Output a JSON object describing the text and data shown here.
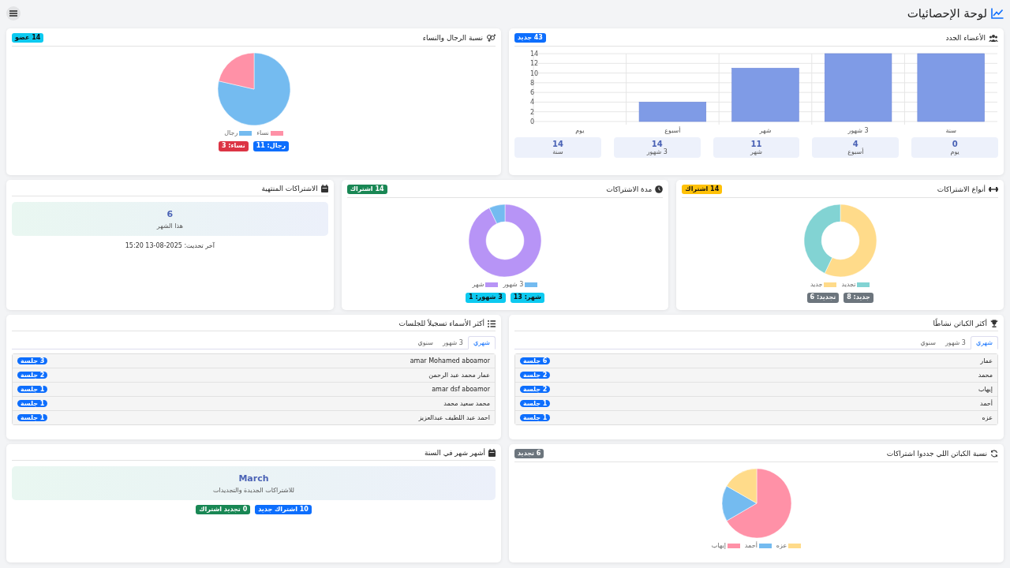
{
  "header": {
    "title": "لوحة الإحصائيات"
  },
  "new_members": {
    "title": "الأعضاء الجدد",
    "badge": {
      "text": "43 جديد",
      "color": "#0d6efd"
    },
    "chart_data": {
      "type": "bar",
      "categories": [
        "يوم",
        "أسبوع",
        "شهر",
        "3 شهور",
        "سنة"
      ],
      "values": [
        0,
        4,
        11,
        14,
        14
      ],
      "ylim": [
        0,
        14
      ],
      "yticks": [
        0,
        2,
        4,
        6,
        8,
        10,
        12,
        14
      ],
      "grid": true
    },
    "stats": [
      {
        "value": "0",
        "label": "يوم"
      },
      {
        "value": "4",
        "label": "أسبوع"
      },
      {
        "value": "11",
        "label": "شهر"
      },
      {
        "value": "14",
        "label": "3 شهور"
      },
      {
        "value": "14",
        "label": "سنة"
      }
    ]
  },
  "gender": {
    "title": "نسبة الرجال والنساء",
    "badge": {
      "text": "14 عضو",
      "color": "#0dcaf0"
    },
    "chart_data": {
      "type": "pie",
      "categories": [
        "رجال",
        "نساء"
      ],
      "values": [
        78.6,
        21.4
      ],
      "colors": [
        "#74bbf0",
        "#ff91a7"
      ],
      "legend": "bottom"
    },
    "badges": [
      {
        "text": "رجال: 11",
        "color": "#0d6efd"
      },
      {
        "text": "نساء: 3",
        "color": "#dc3545"
      }
    ]
  },
  "subscription_types": {
    "title": "أنواع الاشتراكات",
    "badge": {
      "text": "14 اشتراك",
      "color": "#ffc107"
    },
    "chart_data": {
      "type": "donut",
      "categories": [
        "جديد",
        "تجديد"
      ],
      "values": [
        57.1,
        42.9
      ],
      "colors": [
        "#ffdb8a",
        "#82d3d3"
      ],
      "legend": "bottom"
    },
    "badges": [
      {
        "text": "جديد: 8",
        "color": "#6c757d"
      },
      {
        "text": "تجديد: 6",
        "color": "#6c757d"
      }
    ]
  },
  "subscription_duration": {
    "title": "مدة الاشتراكات",
    "badge": {
      "text": "14 اشتراك",
      "color": "#198754"
    },
    "chart_data": {
      "type": "donut",
      "categories": [
        "شهر",
        "3 شهور"
      ],
      "values": [
        92.9,
        7.1
      ],
      "colors": [
        "#b794f6",
        "#74bbf0"
      ],
      "legend": "bottom"
    },
    "badges": [
      {
        "text": "شهر: 13",
        "color": "#0dcaf0"
      },
      {
        "text": "3 شهور: 1",
        "color": "#0dcaf0"
      }
    ]
  },
  "expired": {
    "title": "الاشتراكات المنتهية",
    "value": "6",
    "label": "هذا الشهر",
    "updated": "آخر تحديث: 2025-08-13 15:20"
  },
  "top_captains": {
    "title": "أكثر الكباتن نشاطًا",
    "tabs": [
      {
        "label": "شهري",
        "selected": true
      },
      {
        "label": "3 شهور",
        "selected": false
      },
      {
        "label": "سنوي",
        "selected": false
      }
    ],
    "rows": [
      {
        "name": "عمار",
        "count": "6 جلسة"
      },
      {
        "name": "محمد",
        "count": "2 جلسة"
      },
      {
        "name": "إيهاب",
        "count": "2 جلسة"
      },
      {
        "name": "أحمد",
        "count": "1 جلسة"
      },
      {
        "name": "عزه",
        "count": "1 جلسة"
      }
    ]
  },
  "top_names": {
    "title": "أكثر الأسماء تسجيلاً للجلسات",
    "tabs": [
      {
        "label": "شهري",
        "selected": true
      },
      {
        "label": "3 شهور",
        "selected": false
      },
      {
        "label": "سنوي",
        "selected": false
      }
    ],
    "rows": [
      {
        "name": "amar Mohamed aboamor",
        "count": "3 جلسة"
      },
      {
        "name": "عمار محمد عبد الرحمن",
        "count": "2 جلسة"
      },
      {
        "name": "amar dsf aboamor",
        "count": "1 جلسة"
      },
      {
        "name": "محمد سعيد محمد",
        "count": "1 جلسة"
      },
      {
        "name": "احمد عبد اللطيف عبدالعزيز",
        "count": "1 جلسة"
      }
    ]
  },
  "renewals": {
    "title": "نسبة الكباتن اللي جددوا اشتراكات",
    "badge": {
      "text": "6 تجديد",
      "color": "#6c757d"
    },
    "chart_data": {
      "type": "pie",
      "categories": [
        "إيهاب",
        "أحمد",
        "عزه"
      ],
      "values": [
        66.6,
        16.7,
        16.7
      ],
      "colors": [
        "#ff91a7",
        "#74bbf0",
        "#ffdb8a"
      ],
      "legend": "bottom"
    }
  },
  "top_month": {
    "title": "أشهر شهر في السنة",
    "value": "March",
    "label": "للاشتراكات الجديدة والتجديدات",
    "badges": [
      {
        "text": "10 اشتراك جديد",
        "color": "#0d6efd"
      },
      {
        "text": "0 تجديد اشتراك",
        "color": "#198754"
      }
    ]
  }
}
